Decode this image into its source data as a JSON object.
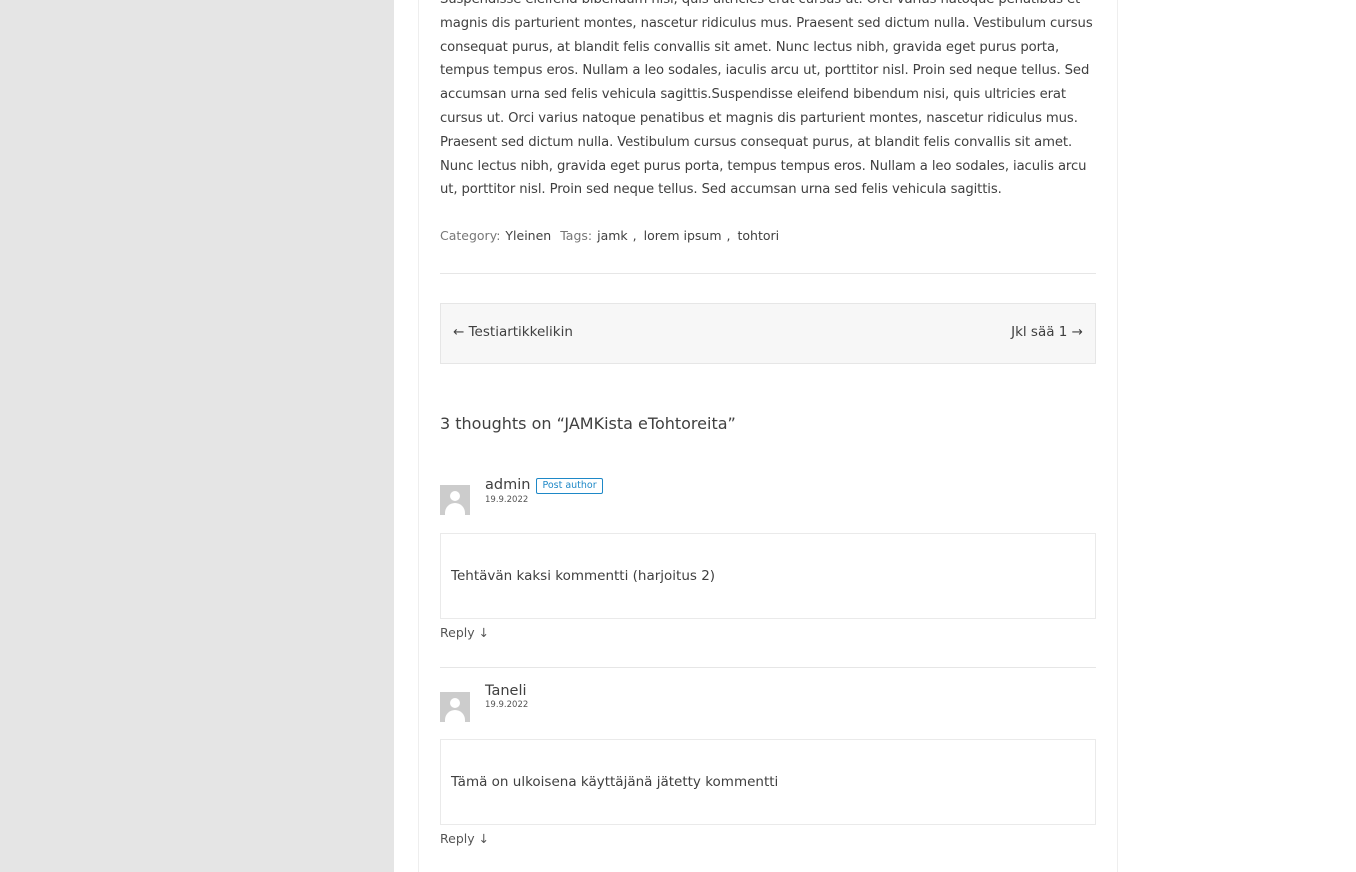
{
  "post": {
    "body": "Suspendisse eleifend bibendum nisi, quis ultricies erat cursus ut. Orci varius natoque penatibus et magnis dis parturient montes, nascetur ridiculus mus. Praesent sed dictum nulla. Vestibulum cursus consequat purus, at blandit felis convallis sit amet. Nunc lectus nibh, gravida eget purus porta, tempus tempus eros. Nullam a leo sodales, iaculis arcu ut, porttitor nisl. Proin sed neque tellus. Sed accumsan urna sed felis vehicula sagittis.Suspendisse eleifend bibendum nisi, quis ultricies erat cursus ut. Orci varius natoque penatibus et magnis dis parturient montes, nascetur ridiculus mus. Praesent sed dictum nulla. Vestibulum cursus consequat purus, at blandit felis convallis sit amet. Nunc lectus nibh, gravida eget purus porta, tempus tempus eros. Nullam a leo sodales, iaculis arcu ut, porttitor nisl. Proin sed neque tellus. Sed accumsan urna sed felis vehicula sagittis.",
    "category_label": "Category:",
    "category": "Yleinen",
    "tags_label": "Tags:",
    "tags": [
      "jamk",
      "lorem ipsum",
      "tohtori"
    ]
  },
  "navigation": {
    "previous": "← Testiartikkelikin",
    "next": "Jkl sää 1 →"
  },
  "comments": {
    "title": "3 thoughts on “JAMKista eTohtoreita”",
    "items": [
      {
        "author": "admin",
        "badge": "Post author",
        "date": "19.9.2022",
        "text": "Tehtävän kaksi kommentti (harjoitus 2)",
        "reply": "Reply ↓"
      },
      {
        "author": "Taneli",
        "date": "19.9.2022",
        "text": "Tämä on ulkoisena käyttäjänä jätetty kommentti",
        "reply": "Reply ↓"
      }
    ]
  },
  "colors": {
    "sidebar_bg": "#e5e5e5",
    "badge": "#1e88c7",
    "text": "#404040"
  }
}
